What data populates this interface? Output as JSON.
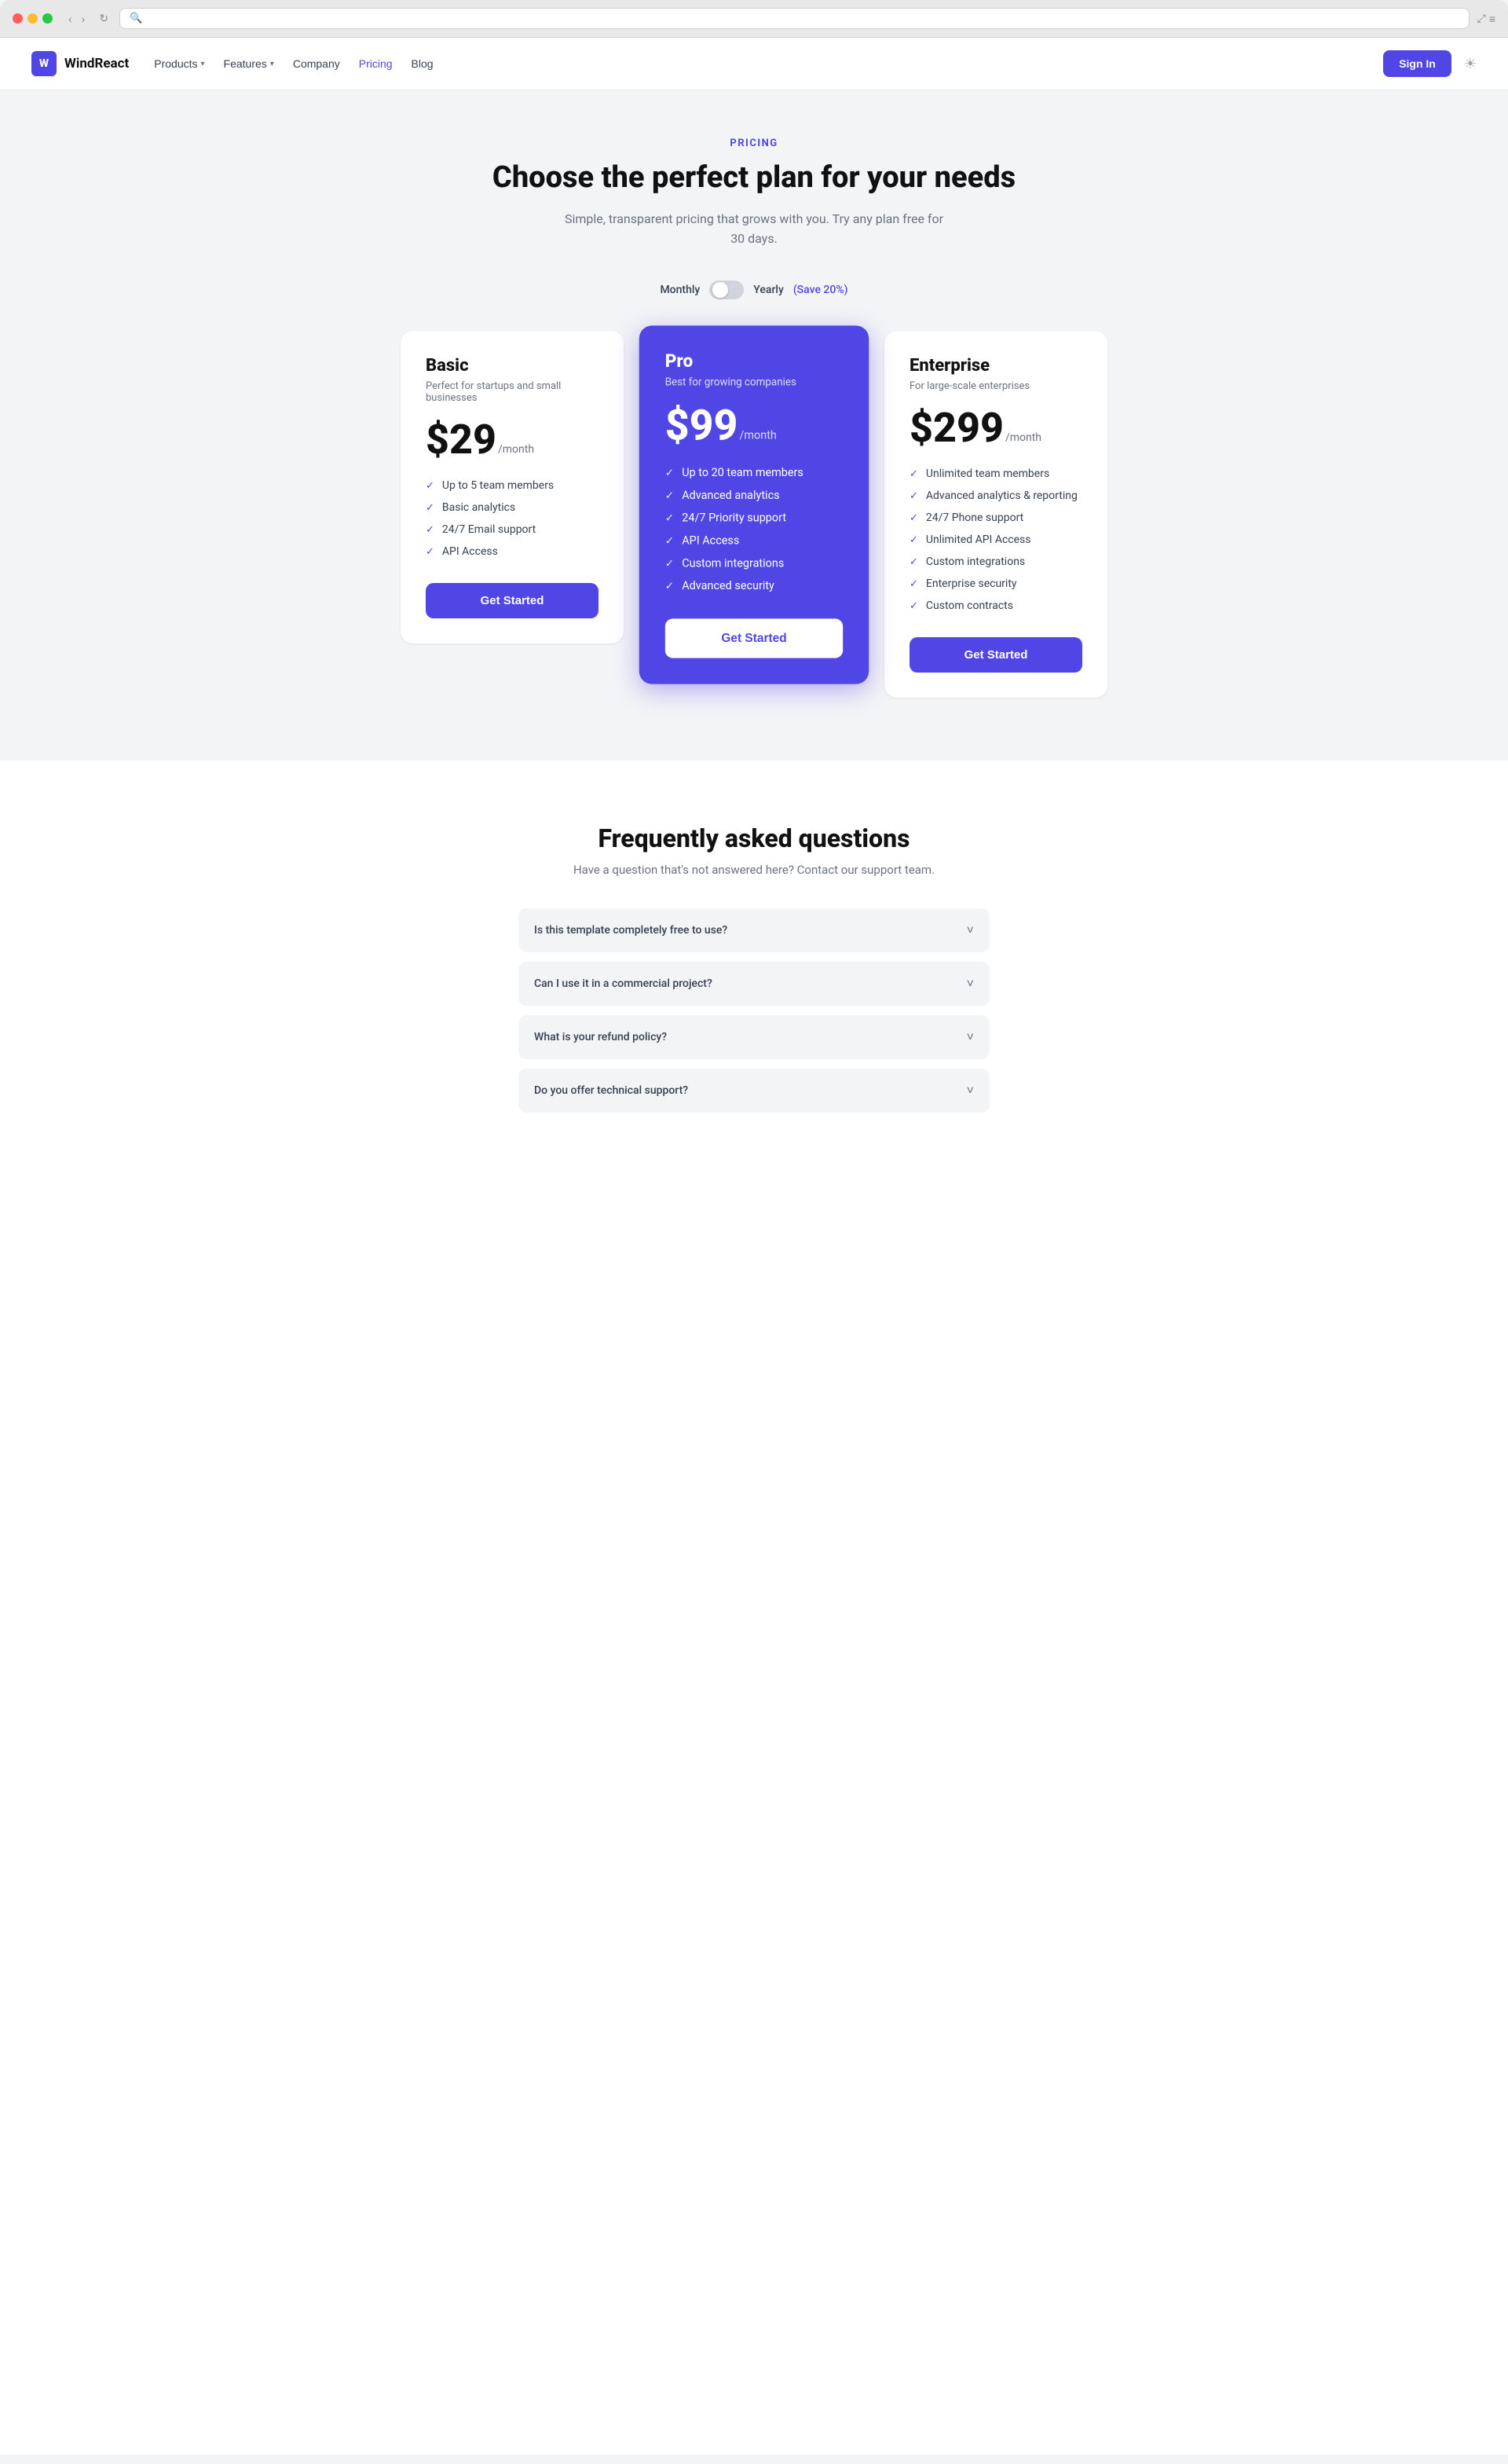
{
  "browser": {
    "address": ""
  },
  "navbar": {
    "logo_letter": "W",
    "logo_name": "WindReact",
    "products_label": "Products",
    "features_label": "Features",
    "company_label": "Company",
    "pricing_label": "Pricing",
    "blog_label": "Blog",
    "signin_label": "Sign In",
    "theme_icon": "☀"
  },
  "hero": {
    "eyebrow": "PRICING",
    "title": "Choose the perfect plan for your needs",
    "subtitle": "Simple, transparent pricing that grows with you. Try any plan free for 30 days."
  },
  "toggle": {
    "monthly_label": "Monthly",
    "yearly_label": "Yearly",
    "save_label": "(Save 20%)"
  },
  "plans": [
    {
      "name": "Basic",
      "desc": "Perfect for startups and small businesses",
      "price": "$29",
      "period": "/month",
      "features": [
        "Up to 5 team members",
        "Basic analytics",
        "24/7 Email support",
        "API Access"
      ],
      "cta": "Get Started",
      "featured": false
    },
    {
      "name": "Pro",
      "desc": "Best for growing companies",
      "price": "$99",
      "period": "/month",
      "features": [
        "Up to 20 team members",
        "Advanced analytics",
        "24/7 Priority support",
        "API Access",
        "Custom integrations",
        "Advanced security"
      ],
      "cta": "Get Started",
      "featured": true
    },
    {
      "name": "Enterprise",
      "desc": "For large-scale enterprises",
      "price": "$299",
      "period": "/month",
      "features": [
        "Unlimited team members",
        "Advanced analytics & reporting",
        "24/7 Phone support",
        "Unlimited API Access",
        "Custom integrations",
        "Enterprise security",
        "Custom contracts"
      ],
      "cta": "Get Started",
      "featured": false
    }
  ],
  "faq": {
    "title": "Frequently asked questions",
    "subtitle": "Have a question that's not answered here? Contact our support team.",
    "items": [
      {
        "question": "Is this template completely free to use?"
      },
      {
        "question": "Can I use it in a commercial project?"
      },
      {
        "question": "What is your refund policy?"
      },
      {
        "question": "Do you offer technical support?"
      }
    ]
  }
}
